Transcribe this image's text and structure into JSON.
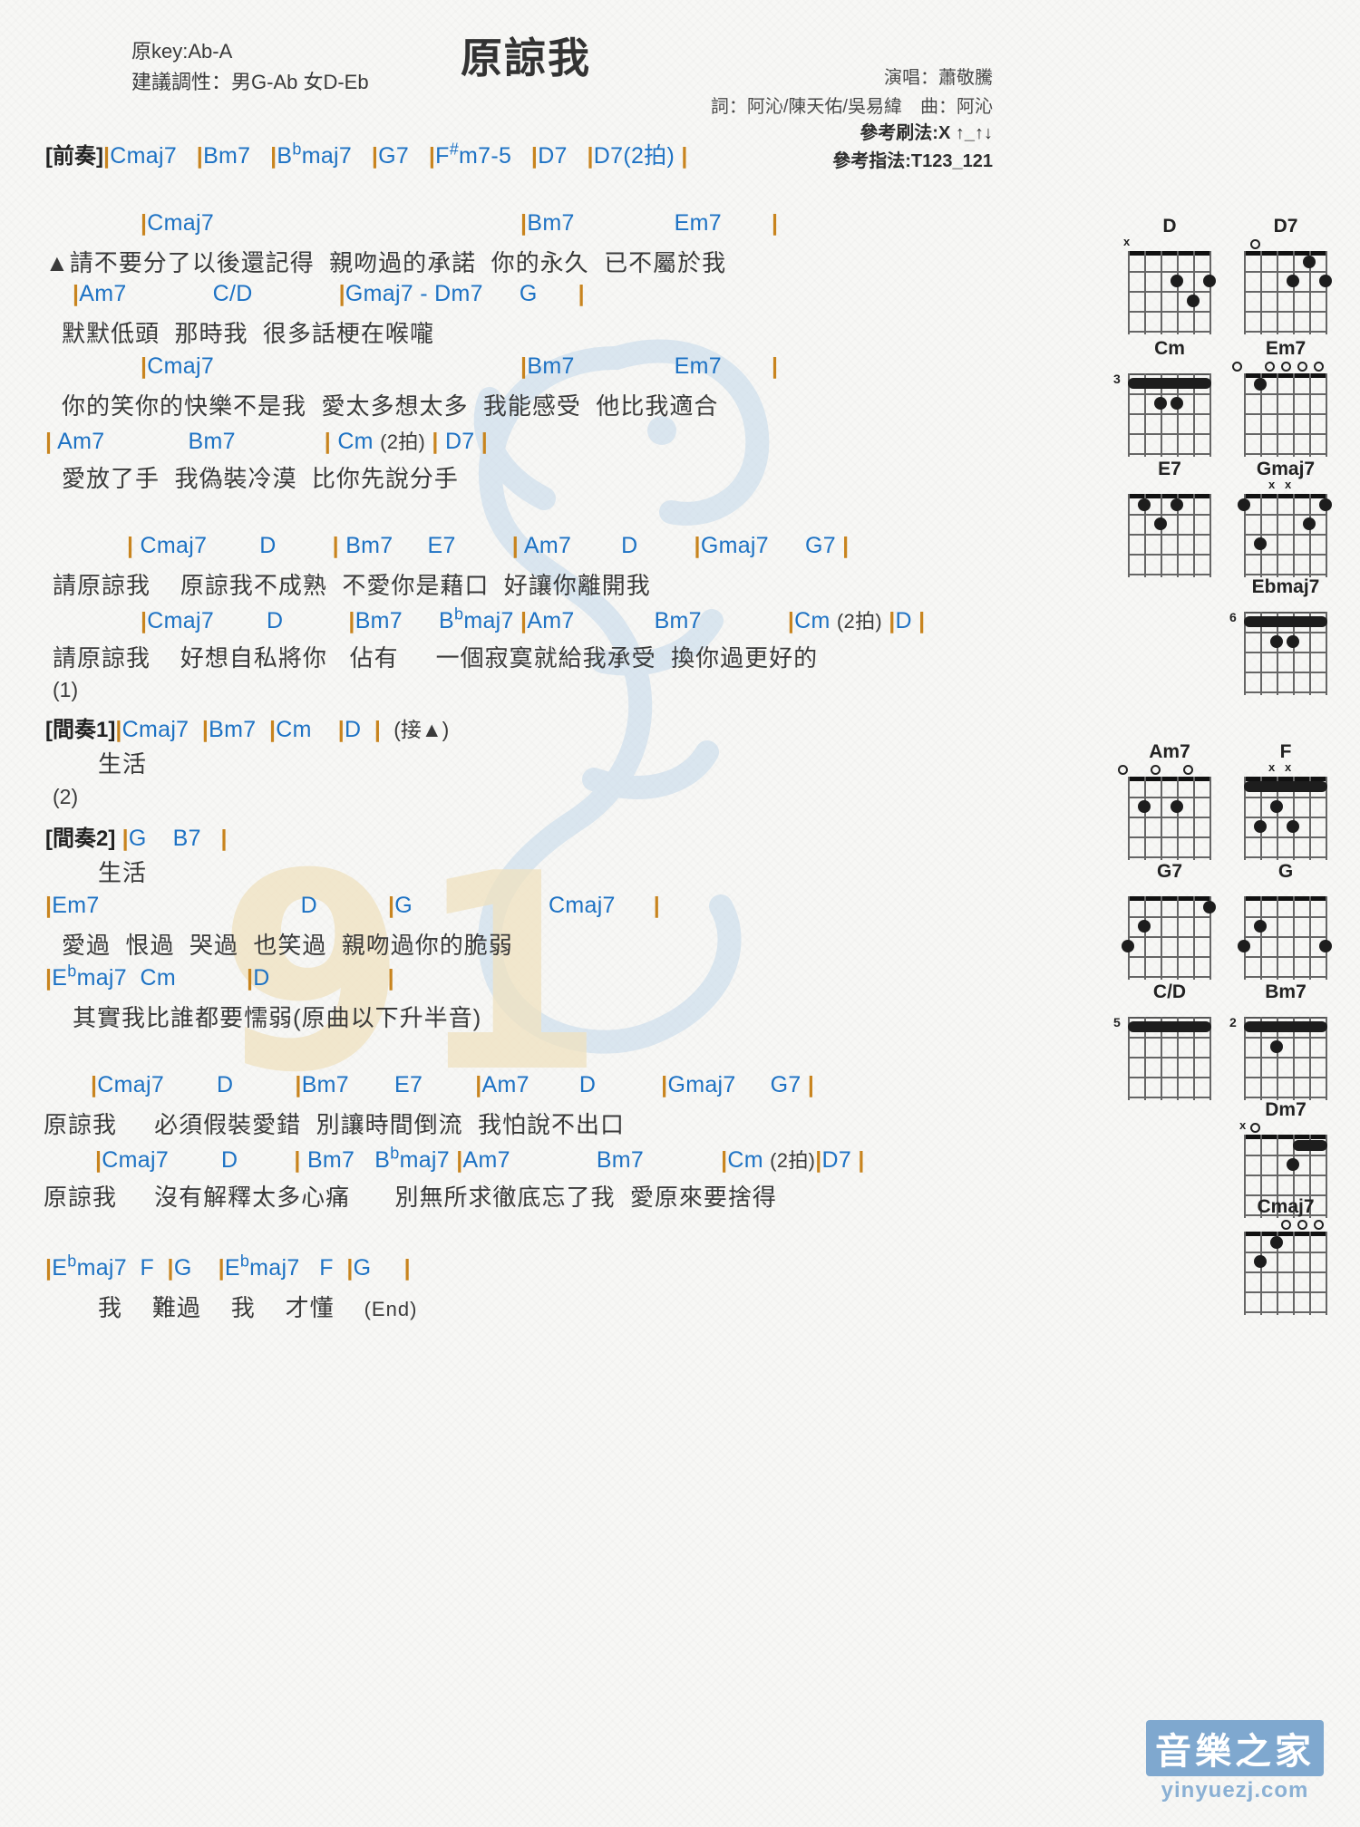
{
  "header": {
    "orig_key": "原key:Ab-A",
    "suggest_key": "建議調性：男G-Ab 女D-Eb",
    "title": "原諒我",
    "singer": "演唱：蕭敬騰",
    "writers": "詞：阿沁/陳天佑/吳易緯　曲：阿沁",
    "strum": "參考刷法:X ↑_↑↓",
    "fingering": "參考指法:T123_121"
  },
  "sections": {
    "intro_label": "[前奏]",
    "interlude1_label": "[間奏1]",
    "interlude2_label": "[間奏2]",
    "mark_a": "▲",
    "repeat1": "(1)",
    "repeat2": "(2)",
    "back_to_a": "(接▲)",
    "end": "(End)"
  },
  "lines": [
    {
      "id": "intro",
      "chords": "|Cmaj7   |Bm7   |B♭maj7   |G7   |F♯m7-5   |D7   |D7(2拍) |",
      "lyrics": ""
    },
    {
      "id": "v1a",
      "chords": "|Cmaj7                                |Bm7          Em7     |",
      "lyrics": "▲請不要分了以後還記得　親吻過的承諾　你的永久　已不屬於我"
    },
    {
      "id": "v1b",
      "chords": "|Am7          C/D          |Gmaj7 - Dm7    G   |",
      "lyrics": "默默低頭　那時我　很多話梗在喉嚨"
    },
    {
      "id": "v1c",
      "chords": "|Cmaj7                                |Bm7          Em7     |",
      "lyrics": "你的笑你的快樂不是我　愛太多想太多　我能感受　他比我適合"
    },
    {
      "id": "v1d",
      "chords": "| Am7        Bm7        | Cm (2拍) | D7 |",
      "lyrics": "愛放了手　我偽裝冷漠　比你先說分手"
    },
    {
      "id": "ch1a",
      "chords": "| Cmaj7      D     | Bm7    E7     | Am7     D      |Gmaj7    G7 |",
      "lyrics": "請原諒我　　原諒我不成熟　不愛你是藉口　好讓你離開我"
    },
    {
      "id": "ch1b",
      "chords": "|Cmaj7      D       |Bm7    B♭maj7 |Am7        Bm7           |Cm (2拍) |D |",
      "lyrics": "請原諒我　　好想自私將你　佔有　　一個寂寞就給我承受　換你過更好的"
    },
    {
      "id": "int1",
      "chords": "|Cmaj7   |Bm7   |Cm    |D   | (接▲)",
      "lyrics": "生活"
    },
    {
      "id": "int2",
      "chords": "|G    B7   |",
      "lyrics": "生活"
    },
    {
      "id": "br1",
      "chords": "|Em7                    D        |G             Cmaj7   |",
      "lyrics": "愛過　恨過　哭過　也笑過　親吻過你的脆弱"
    },
    {
      "id": "br2",
      "chords": "|E♭maj7  Cm       |D           |",
      "lyrics": "其實我比誰都要懦弱(原曲以下升半音)"
    },
    {
      "id": "ch2a",
      "chords": "|Cmaj7    D      |Bm7    E7      |Am7    D      |Gmaj7   G7 |",
      "lyrics": "原諒我　　必須假裝愛錯　別讓時間倒流　我怕說不出口"
    },
    {
      "id": "ch2b",
      "chords": "|Cmaj7    D     | Bm7  B♭maj7  |Am7        Bm7         |Cm (2拍)|D7  |",
      "lyrics": "原諒我　　沒有解釋太多心痛　　別無所求徹底忘了我　愛原來要捨得"
    },
    {
      "id": "outro",
      "chords": "|E♭maj7   F  |G    |E♭maj7    F  |G     |",
      "lyrics": "我　　難過　　我　　才懂　　(End)"
    }
  ],
  "chord_diagrams": [
    {
      "name": "D",
      "fret_label": "",
      "markers": "x",
      "open": ""
    },
    {
      "name": "D7",
      "fret_label": "",
      "markers": "",
      "open": "o"
    },
    {
      "name": "Cm",
      "fret_label": "3",
      "markers": "",
      "open": ""
    },
    {
      "name": "Em7",
      "fret_label": "",
      "markers": "",
      "open": "o oooo"
    },
    {
      "name": "E7",
      "fret_label": "",
      "markers": "",
      "open": ""
    },
    {
      "name": "Gmaj7",
      "fret_label": "",
      "markers": "x x",
      "open": ""
    },
    {
      "name": "Ebmaj7",
      "fret_label": "6",
      "markers": "",
      "open": ""
    },
    {
      "name": "Am7",
      "fret_label": "",
      "markers": "",
      "open": "o o o"
    },
    {
      "name": "F",
      "fret_label": "",
      "markers": "x x",
      "open": ""
    },
    {
      "name": "G7",
      "fret_label": "",
      "markers": "",
      "open": ""
    },
    {
      "name": "G",
      "fret_label": "",
      "markers": "",
      "open": ""
    },
    {
      "name": "C/D",
      "fret_label": "5",
      "markers": "",
      "open": ""
    },
    {
      "name": "Bm7",
      "fret_label": "2",
      "markers": "",
      "open": ""
    },
    {
      "name": "Dm7",
      "fret_label": "",
      "markers": "x",
      "open": "o"
    },
    {
      "name": "Cmaj7",
      "fret_label": "",
      "markers": "",
      "open": "ooo"
    }
  ],
  "brand": {
    "cn": "音樂之家",
    "en": "yinyuezj.com"
  },
  "colors": {
    "chord": "#1d72c4",
    "bar": "#c8841e",
    "lyric": "#3a3a3a",
    "watermark_blue": "#b9d2e8",
    "watermark_gold": "#f0e2c0"
  }
}
